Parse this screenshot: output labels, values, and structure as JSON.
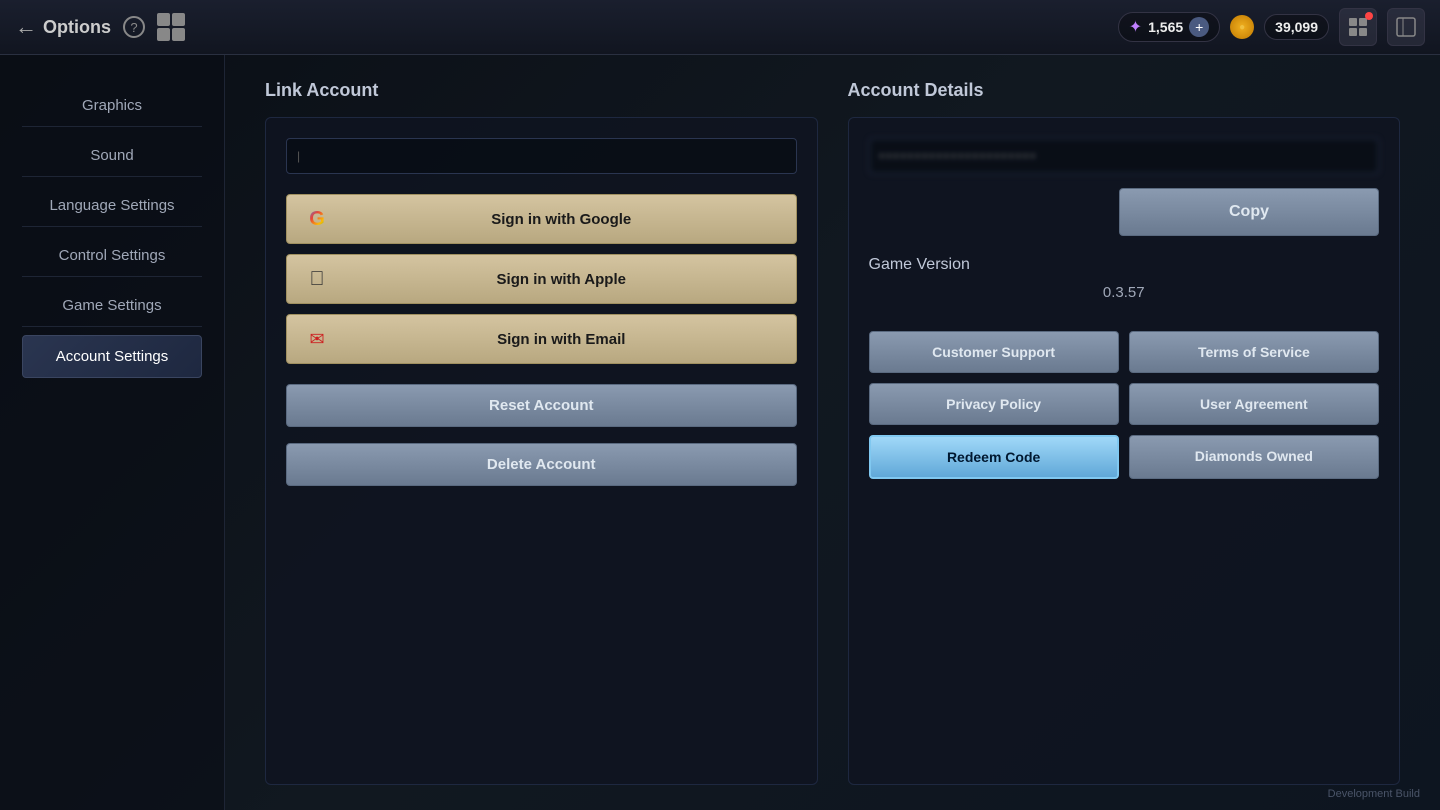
{
  "topbar": {
    "back_label": "Options",
    "currency_stars": "1,565",
    "currency_coins": "39,099",
    "help_icon": "?",
    "dev_build": "Development Build"
  },
  "sidebar": {
    "items": [
      {
        "id": "graphics",
        "label": "Graphics"
      },
      {
        "id": "sound",
        "label": "Sound"
      },
      {
        "id": "language",
        "label": "Language Settings"
      },
      {
        "id": "control",
        "label": "Control Settings"
      },
      {
        "id": "game",
        "label": "Game Settings"
      },
      {
        "id": "account",
        "label": "Account Settings"
      }
    ]
  },
  "link_account": {
    "title": "Link Account",
    "google_label": "Sign in with Google",
    "apple_label": "Sign in with Apple",
    "email_label": "Sign in with Email",
    "reset_label": "Reset Account",
    "delete_label": "Delete Account"
  },
  "account_details": {
    "title": "Account Details",
    "copy_label": "Copy",
    "game_version_label": "Game Version",
    "version_number": "0.3.57",
    "customer_support_label": "Customer Support",
    "terms_label": "Terms of Service",
    "privacy_label": "Privacy Policy",
    "user_agreement_label": "User Agreement",
    "redeem_code_label": "Redeem Code",
    "diamonds_owned_label": "Diamonds Owned"
  }
}
